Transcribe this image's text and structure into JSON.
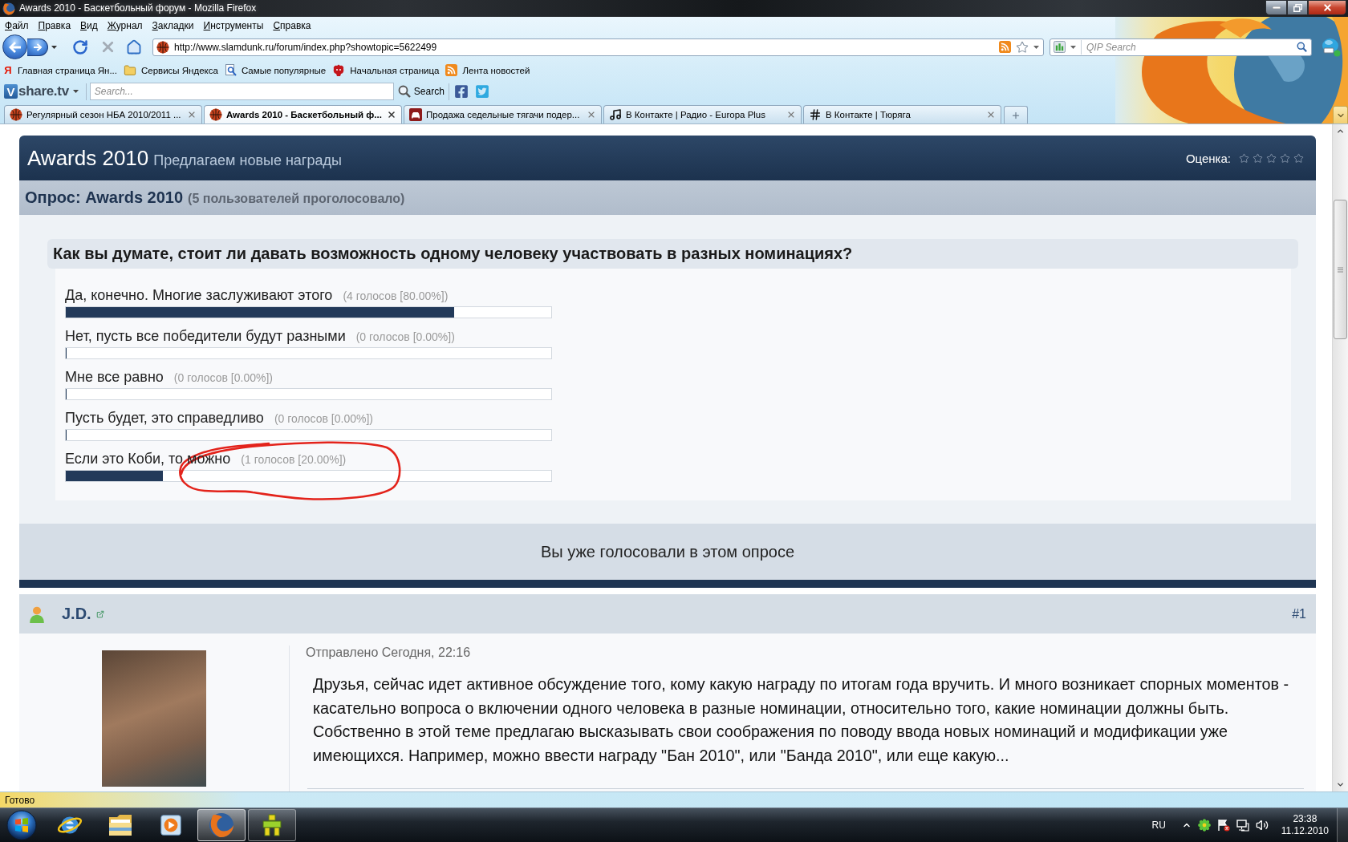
{
  "window": {
    "title": "Awards 2010 - Баскетбольный форум - Mozilla Firefox"
  },
  "menu_bar": [
    "Файл",
    "Правка",
    "Вид",
    "Журнал",
    "Закладки",
    "Инструменты",
    "Справка"
  ],
  "navigation": {
    "url": "http://www.slamdunk.ru/forum/index.php?showtopic=5622499",
    "search_placeholder": "QIP Search"
  },
  "bookmarks": [
    {
      "kind": "letter",
      "badge": "Я",
      "label": "Главная страница Ян..."
    },
    {
      "kind": "folder",
      "label": "Сервисы Яндекса"
    },
    {
      "kind": "page",
      "label": "Самые популярные"
    },
    {
      "kind": "animal",
      "label": "Начальная страница"
    },
    {
      "kind": "rss",
      "label": "Лента новостей"
    }
  ],
  "toolbar": {
    "logo_mark": "V",
    "logo_text": "share.tv",
    "search_placeholder": "Search...",
    "search_button": "Search"
  },
  "tabs": [
    {
      "kind": "ball",
      "title": "Регулярный сезон НБА 2010/2011 ...",
      "selected": false
    },
    {
      "kind": "ball",
      "title": "Awards 2010 - Баскетбольный ф...",
      "selected": true
    },
    {
      "kind": "car",
      "title": "Продажа седельные тягачи подер...",
      "selected": false
    },
    {
      "kind": "note",
      "title": "В Контакте | Радио - Europa Plus",
      "selected": false
    },
    {
      "kind": "hash",
      "title": "В Контакте | Тюряга",
      "selected": false
    }
  ],
  "topic": {
    "title": "Awards 2010",
    "subtitle": "Предлагаем новые награды",
    "rating_label": "Оценка:",
    "stars": 0
  },
  "poll": {
    "title": "Опрос: Awards 2010",
    "voters": "(5 пользователей проголосовало)",
    "question": "Как вы думате, стоит ли давать возможность одному человеку участвовать в разных номинациях?",
    "options": [
      {
        "label": "Да, конечно. Многие заслуживают этого",
        "votes": "(4 голосов [80.00%])",
        "level": 0.8,
        "circled": false
      },
      {
        "label": "Нет, пусть все победители будут разными",
        "votes": "(0 голосов [0.00%])",
        "level": 0,
        "circled": false
      },
      {
        "label": "Мне все равно",
        "votes": "(0 голосов [0.00%])",
        "level": 0,
        "circled": false
      },
      {
        "label": "Пусть будет, это справедливо",
        "votes": "(0 голосов [0.00%])",
        "level": 0,
        "circled": false
      },
      {
        "label": "Если это Коби, то можно",
        "votes": "(1 голосов [20.00%])",
        "level": 0.2,
        "circled": true
      }
    ],
    "voted_message": "Вы уже голосовали в этом опросе"
  },
  "post": {
    "author": "J.D.",
    "number": "#1",
    "posted": "Отправлено Сегодня, 22:16",
    "text": "Друзья, сейчас идет активное обсуждение того, кому какую награду по итогам года вручить. И много возникает спорных моментов -\nкасательно вопроса о включении одного человека в разные номинации, относительно того, какие номинации должны быть.\nСобственно в этой теме предлагаю высказывать свои соображения по поводу ввода новых номинаций и модификации уже\nимеющихся. Например, можно ввести награду \"Бан 2010\", или \"Банда 2010\", или еще какую..."
  },
  "status_bar": {
    "text": "Готово"
  },
  "taskbar": {
    "apps": [
      {
        "kind": "ie",
        "running": false,
        "selected": false
      },
      {
        "kind": "explorer",
        "running": false,
        "selected": false
      },
      {
        "kind": "media",
        "running": false,
        "selected": false
      },
      {
        "kind": "firefox",
        "running": true,
        "selected": true
      },
      {
        "kind": "qip",
        "running": true,
        "selected": false
      }
    ],
    "language": "RU",
    "time": "23:38",
    "date": "11.12.2010"
  }
}
